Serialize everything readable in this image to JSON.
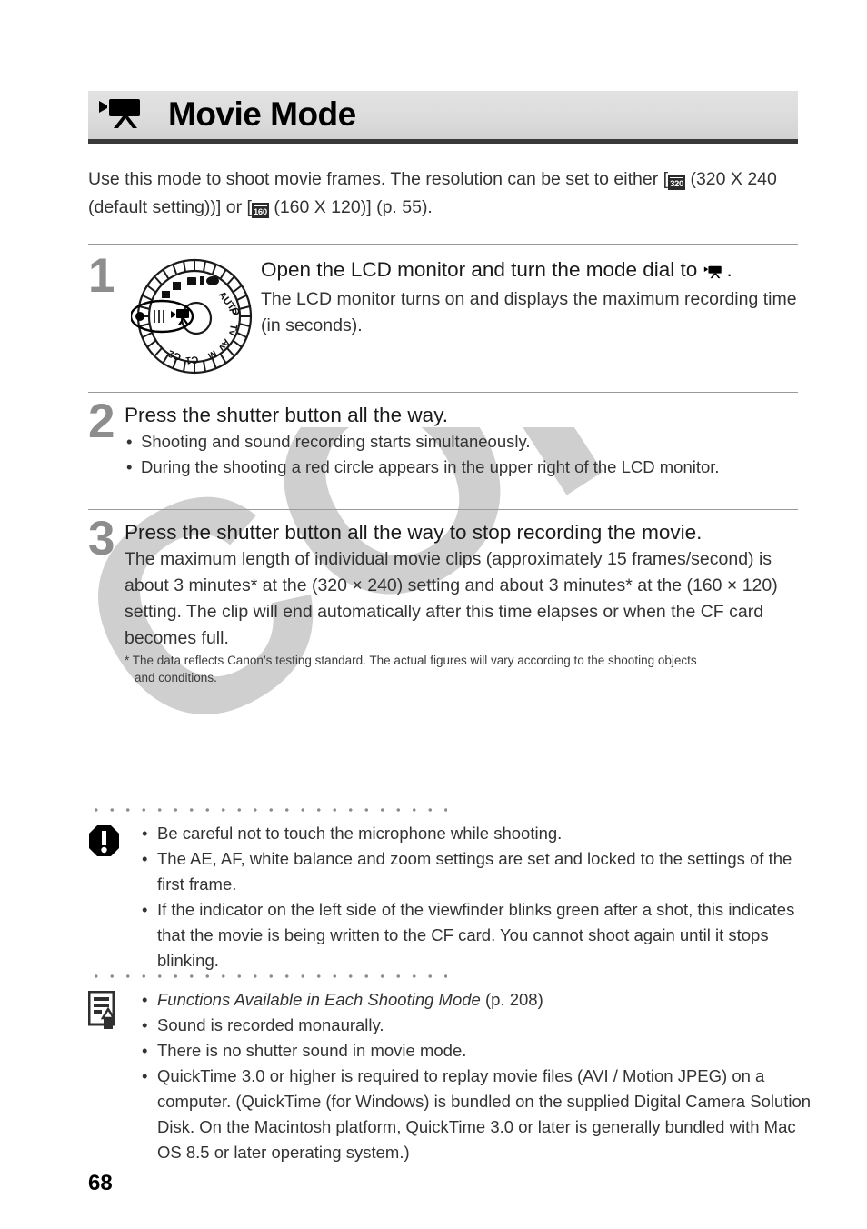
{
  "page": {
    "number": "68",
    "watermark": "COPY"
  },
  "header": {
    "title": "Movie Mode",
    "icon": "movie-camera-icon"
  },
  "intro": {
    "part1": "Use this mode to shoot movie frames. The resolution can be set to either [",
    "badge1": "320",
    "part2": " (320 X 240 (default setting))] or [",
    "badge2": "160",
    "part3": " (160 X 120)] (p. 55)."
  },
  "steps": [
    {
      "number": "1",
      "illustration": "mode-dial-illustration",
      "heading_part1": "Open the LCD monitor and turn the mode dial to ",
      "heading_icon": "movie-camera-icon",
      "heading_part2": ".",
      "sub": "The LCD monitor turns on and displays the maximum recording time (in seconds).",
      "bullets": []
    },
    {
      "number": "2",
      "heading": "Press the shutter button all the way.",
      "bullets": [
        "Shooting and sound recording starts simultaneously.",
        "During the shooting a red circle appears in the upper right of the LCD monitor."
      ]
    },
    {
      "number": "3",
      "heading": "Press the shutter button all the way to stop recording the movie.",
      "sub": "The maximum length of individual movie clips (approximately 15 frames/second) is about 3 minutes* at the (320 × 240) setting and about 3 minutes* at the (160 × 120) setting. The clip will end automatically after this time elapses or when the CF card becomes full.",
      "footnote_line1": "* The data reflects Canon’s testing standard. The actual figures will vary according to the shooting objects",
      "footnote_line2": "and conditions.",
      "bullets": []
    }
  ],
  "caution": {
    "icon": "caution-exclamation-icon",
    "items": [
      "Be careful not to touch the microphone while shooting.",
      "The AE, AF, white balance and zoom settings are set and locked to the settings of the first frame.",
      "If the indicator on the left side of the viewfinder blinks green after a shot, this indicates that the movie is being written to the CF card. You cannot shoot again until it stops blinking."
    ]
  },
  "notes": {
    "icon": "note-pencil-icon",
    "item1_italic": "Functions Available in Each Shooting Mode",
    "item1_rest": " (p. 208)",
    "items": [
      "Sound is recorded monaurally.",
      "There is no shutter sound in movie mode.",
      "QuickTime 3.0 or higher is required to replay movie files (AVI / Motion JPEG) on a computer. (QuickTime (for Windows) is bundled on the supplied Digital Camera Solution Disk. On the Macintosh platform, QuickTime 3.0 or later is generally bundled with Mac OS 8.5 or later operating system.)"
    ]
  },
  "dial": {
    "labels": [
      "AUTO",
      "P",
      "Tv",
      "Av",
      "M",
      "C1",
      "C2"
    ]
  },
  "colors": {
    "header_bg": "#dcdcdc",
    "header_rule": "#3a3a3a",
    "step_number": "#8d8d8d",
    "text": "#333333",
    "watermark": "#cfcfcf"
  }
}
